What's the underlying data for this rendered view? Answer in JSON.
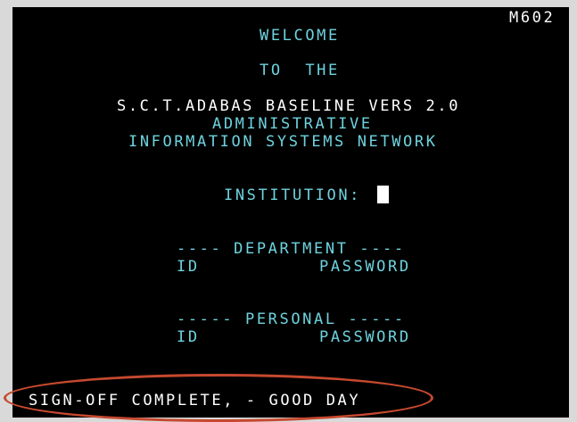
{
  "terminal": {
    "screen_id": "M602",
    "welcome": "WELCOME",
    "to_the": "TO  THE",
    "product": "S.C.T.ADABAS BASELINE VERS 2.0",
    "admin": "ADMINISTRATIVE",
    "network": "INFORMATION SYSTEMS NETWORK",
    "institution_label": "INSTITUTION:",
    "institution_value": "",
    "department_header": "---- DEPARTMENT ----",
    "department_id_label": "ID",
    "department_password_label": "PASSWORD",
    "personal_header": "----- PERSONAL -----",
    "personal_id_label": "ID",
    "personal_password_label": "PASSWORD",
    "status_message": "SIGN-OFF COMPLETE, - GOOD DAY"
  },
  "colors": {
    "background": "#000000",
    "cyan_text": "#6ed3df",
    "white_text": "#ffffff",
    "highlight_oval": "#c6492f"
  }
}
